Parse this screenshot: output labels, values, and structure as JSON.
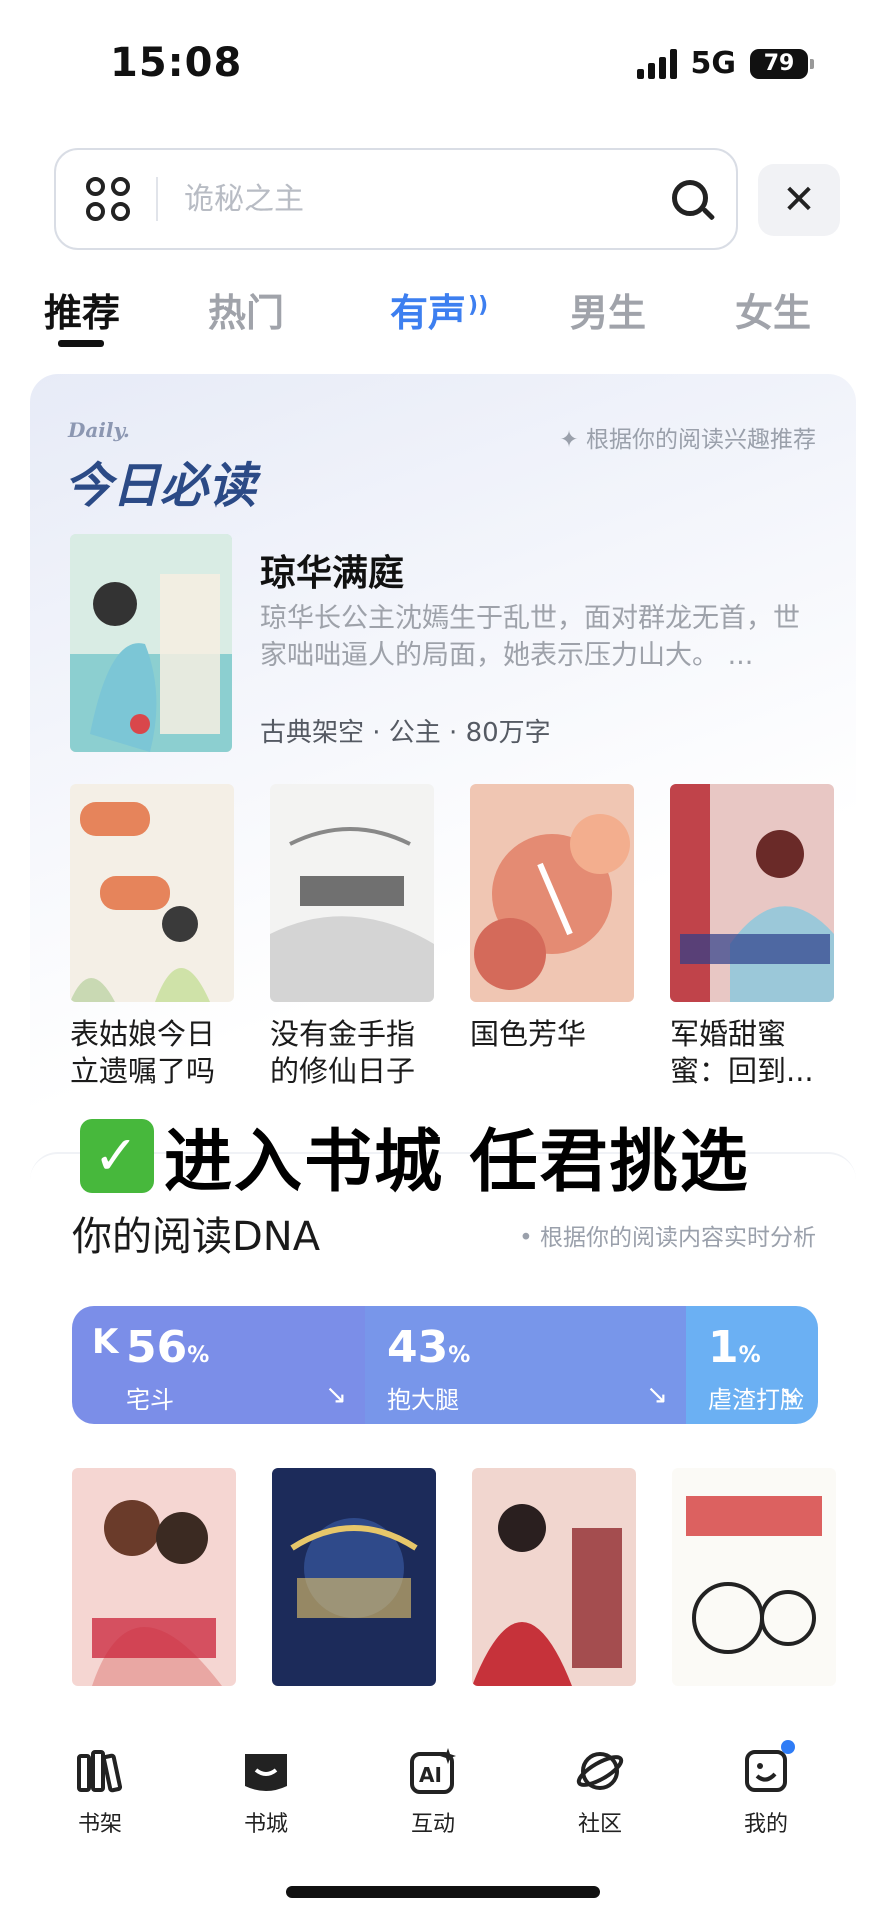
{
  "status_bar": {
    "time": "15:08",
    "network": "5G",
    "battery": "79"
  },
  "search": {
    "placeholder": "诡秘之主"
  },
  "tabs": [
    {
      "label": "推荐"
    },
    {
      "label": "热门"
    },
    {
      "label": "有声"
    },
    {
      "label": "男生"
    },
    {
      "label": "女生"
    }
  ],
  "daily": {
    "en_label": "Daily.",
    "title": "今日必读",
    "hint": "✦ 根据你的阅读兴趣推荐",
    "featured": {
      "name": "琼华满庭",
      "description": "琼华长公主沈嫣生于乱世，面对群龙无首，世家咄咄逼人的局面，她表示压力山大。 ...",
      "tags": "古典架空 · 公主 · 80万字"
    },
    "books": [
      {
        "name": "表姑娘今日立遗嘱了吗"
      },
      {
        "name": "没有金手指的修仙日子"
      },
      {
        "name": "国色芳华"
      },
      {
        "name": "军婚甜蜜蜜：回到..."
      }
    ]
  },
  "overlay": {
    "text": "进入书城 任君挑选"
  },
  "dna": {
    "title": "你的阅读DNA",
    "hint": "• 根据你的阅读内容实时分析",
    "segments": [
      {
        "value": 56,
        "unit": "%",
        "label": "宅斗",
        "color": "#7b8ee8"
      },
      {
        "value": 43,
        "unit": "%",
        "label": "抱大腿",
        "color": "#7896ea"
      },
      {
        "value": 1,
        "unit": "%",
        "label": "虐渣打脸",
        "color": "#6bb0f3"
      }
    ]
  },
  "nav": [
    {
      "label": "书架",
      "icon": "bookshelf-icon"
    },
    {
      "label": "书城",
      "icon": "bookstore-icon"
    },
    {
      "label": "互动",
      "icon": "ai-icon"
    },
    {
      "label": "社区",
      "icon": "planet-icon"
    },
    {
      "label": "我的",
      "icon": "profile-icon"
    }
  ]
}
